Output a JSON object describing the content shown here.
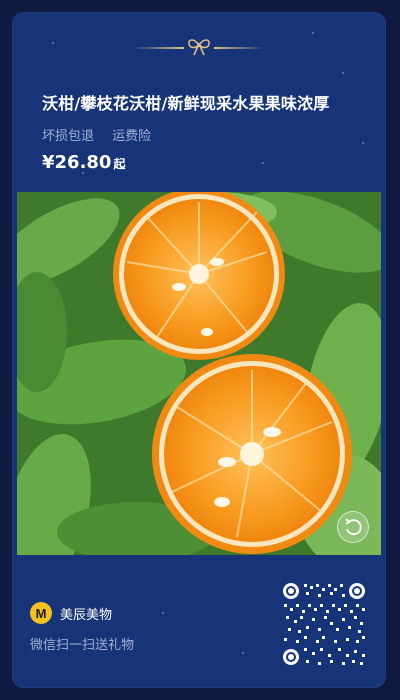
{
  "product": {
    "title": "沃柑/攀枝花沃柑/新鲜现采水果果味浓厚",
    "tags": [
      "坏损包退",
      "运费险"
    ],
    "price": "¥26.80",
    "price_suffix": "起"
  },
  "brand": {
    "logo_text": "M",
    "name": "美辰美物",
    "scan_hint": "微信扫一扫送礼物"
  },
  "icons": {
    "decoration": "bow-icon",
    "photo_action": "rotate-icon",
    "share_code": "qr-code"
  },
  "colors": {
    "background": "#0e1a3f",
    "card": "#173479",
    "accent_gold": "#e0bd84",
    "brand_yellow": "#f4c21e"
  }
}
